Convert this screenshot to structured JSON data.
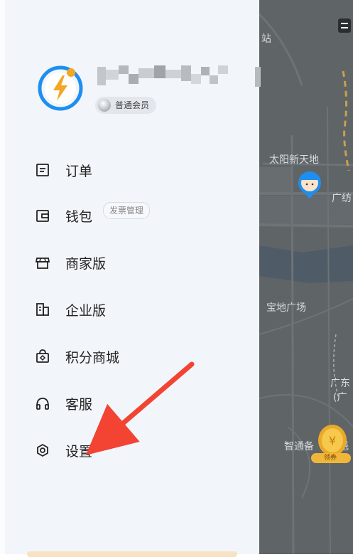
{
  "profile": {
    "member_level": "普通会员"
  },
  "menu": {
    "orders": "订单",
    "wallet": "钱包",
    "invoice_manage": "发票管理",
    "merchant": "商家版",
    "enterprise": "企业版",
    "points_mall": "积分商城",
    "customer_service": "客服",
    "settings": "设置"
  },
  "map": {
    "label_station": "站",
    "label_taiyang": "太阳新天地",
    "label_guangfang": "广纺",
    "label_baodi": "宝地广场",
    "label_guangdong": "广东",
    "label_guang_paren": "(广",
    "label_zhitong": "智通备",
    "label_kui": "魁",
    "coupon_label": "领券"
  },
  "colors": {
    "drawer_bg": "#f2f6fa",
    "map_bg": "#5f6467",
    "accent_blue": "#1e8ff0",
    "accent_orange": "#f5a623",
    "arrow_red": "#f24333"
  }
}
